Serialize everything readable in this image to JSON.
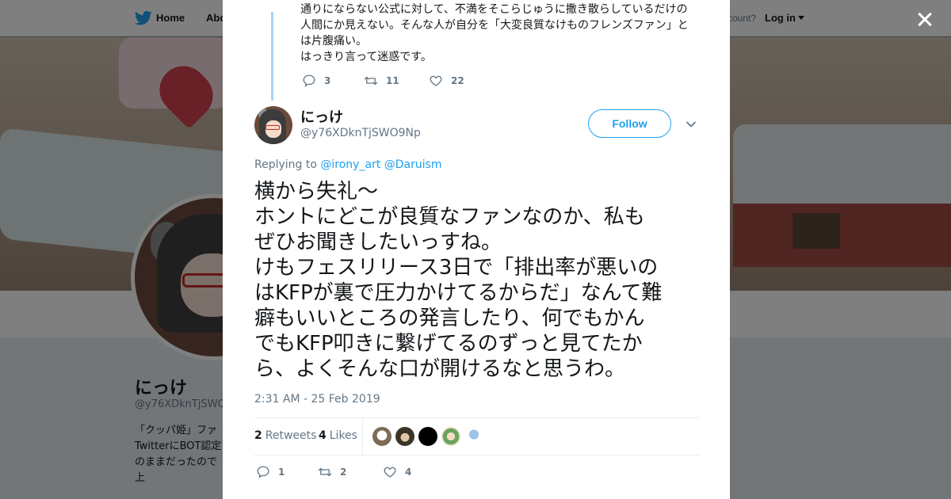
{
  "nav": {
    "home": "Home",
    "about": "Abo",
    "account_prompt": "ccount?",
    "login": "Log in"
  },
  "profile": {
    "name": "にっけ",
    "handle": "@y76XDknTjSWO",
    "bio": "「クッパ姫」ファ\nTwitterにBOT認定\nのままだったので\n上"
  },
  "parent_tweet": {
    "lines": [
      "通りにならない公式に対して、不満をそこらじゅうに撒き散らしているだけの",
      "人間にか見えない。そんな人が自分を「大変良質なけものフレンズファン」と",
      "は片腹痛い。",
      "はっきり言って迷惑です。"
    ],
    "replies": "3",
    "retweets": "11",
    "likes": "22"
  },
  "tweet": {
    "author_name": "にっけ",
    "author_handle": "@y76XDknTjSWO9Np",
    "follow_label": "Follow",
    "replying_to_label": "Replying to",
    "replying_to_1": "@irony_art",
    "replying_to_2": "@Daruism",
    "lines": [
      "横から失礼〜",
      "ホントにどこが良質なファンなのか、私も",
      "ぜひお聞きしたいっすね。",
      "けもフェスリリース3日で「排出率が悪いの",
      "はKFPが裏で圧力かけてるからだ」なんて難",
      "癖もいいところの発言したり、何でもかん",
      "でもKFP叩きに繋げてるのずっと見てたか",
      "ら、よくそんな口が開けるなと思うわ。"
    ],
    "timestamp": "2:31 AM - 25 Feb 2019",
    "retweets_count": "2",
    "retweets_label": "Retweets",
    "likes_count": "4",
    "likes_label": "Likes",
    "reply_count": "1",
    "retweet_action_count": "2",
    "like_action_count": "4"
  },
  "colors": {
    "accent": "#1da1f2",
    "thread": "#a9d2f5",
    "muted": "#657786"
  },
  "icons": [
    "twitter-bird-icon",
    "close-icon",
    "reply-icon",
    "retweet-icon",
    "like-icon",
    "chevron-down-icon"
  ]
}
